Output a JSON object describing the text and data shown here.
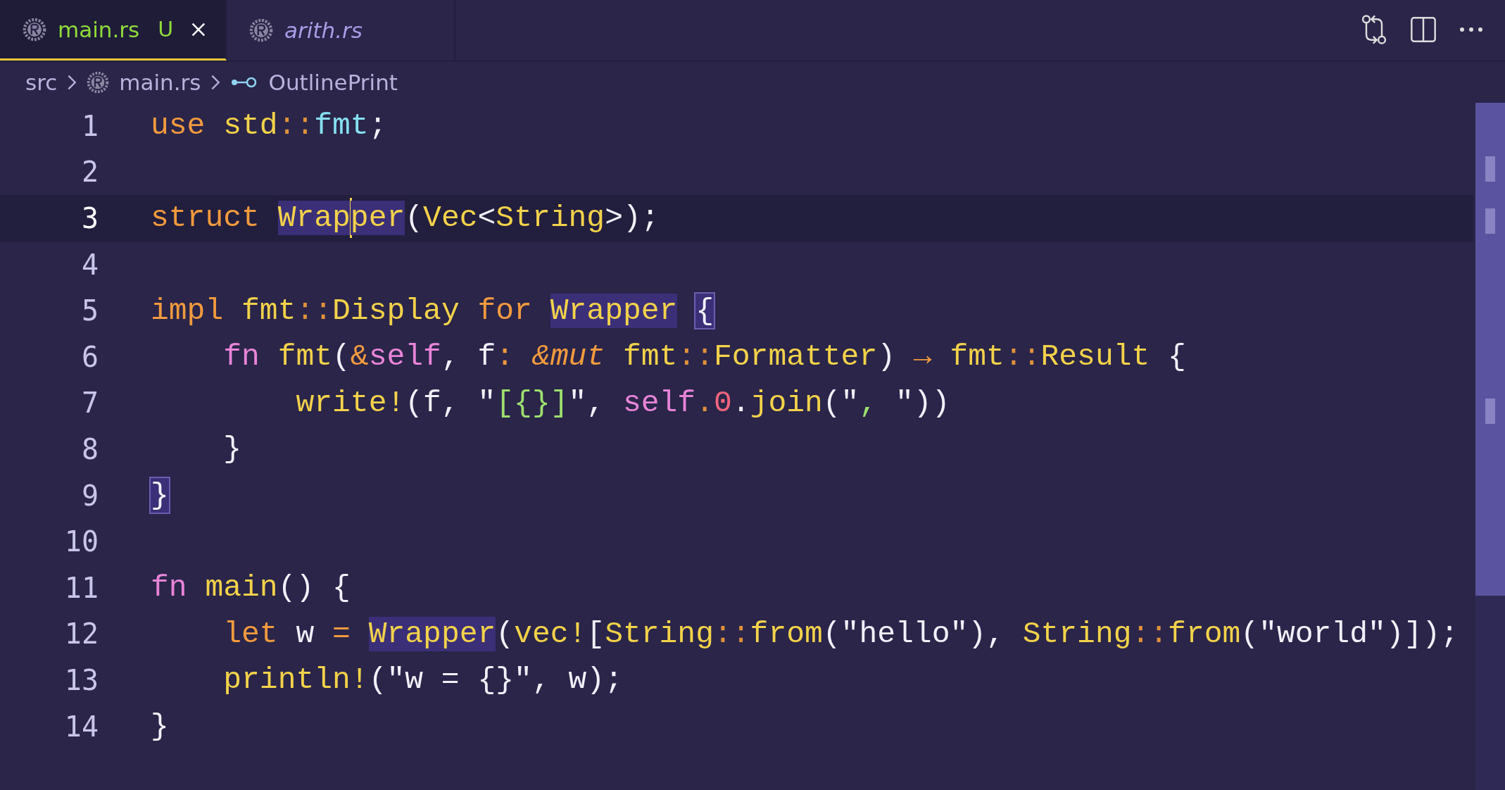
{
  "tabs": [
    {
      "label": "main.rs",
      "selected": true,
      "preview": false,
      "badge": "U",
      "closable": true
    },
    {
      "label": "arith.rs",
      "selected": false,
      "preview": true,
      "closable": false
    }
  ],
  "breadcrumb": [
    {
      "text": "src",
      "kind": "folder"
    },
    {
      "text": "main.rs",
      "kind": "file"
    },
    {
      "text": "OutlinePrint",
      "kind": "symbol"
    }
  ],
  "lines": [
    {
      "number": "1",
      "current": false,
      "tokens": [
        {
          "text": "use ",
          "kind": "keyword"
        },
        {
          "text": "std",
          "kind": "type"
        },
        {
          "text": "::",
          "kind": "op"
        },
        {
          "text": "fmt",
          "kind": "module"
        },
        {
          "text": ";",
          "kind": "plain"
        }
      ]
    },
    {
      "number": "2",
      "current": false
    },
    {
      "number": "3",
      "current": true,
      "tokens": [
        {
          "text": "struct ",
          "kind": "keyword"
        },
        {
          "text": "Wrap",
          "kind": "type",
          "highlighted": true,
          "caret": true
        },
        {
          "text": "per",
          "kind": "type",
          "highlighted": true
        },
        {
          "text": "(",
          "kind": "plain"
        },
        {
          "text": "Vec",
          "kind": "type"
        },
        {
          "text": "<",
          "kind": "plain"
        },
        {
          "text": "String",
          "kind": "type"
        },
        {
          "text": ">);",
          "kind": "plain"
        }
      ]
    },
    {
      "number": "4",
      "current": false
    },
    {
      "number": "5",
      "current": false,
      "tokens": [
        {
          "text": "impl ",
          "kind": "keyword"
        },
        {
          "text": "fmt",
          "kind": "type"
        },
        {
          "text": "::",
          "kind": "op"
        },
        {
          "text": "Display",
          "kind": "type"
        },
        {
          "text": " for ",
          "kind": "keyword"
        },
        {
          "text": "Wrapper",
          "kind": "type",
          "highlighted": true
        },
        {
          "text": "{",
          "kind": "plain",
          "bracket_match": true
        }
      ]
    },
    {
      "number": "6",
      "current": false,
      "tokens": [
        {
          "text": "    fn",
          "kind": "self"
        },
        {
          "text": " fmt",
          "kind": "type"
        },
        {
          "text": "(",
          "kind": "plain"
        },
        {
          "text": "&",
          "kind": "keyword"
        },
        {
          "text": "self",
          "kind": "self"
        },
        {
          "text": ", f",
          "kind": "plain"
        },
        {
          "text": ":",
          "kind": "keyword"
        },
        {
          "text": " &mut",
          "kind": "modifier"
        },
        {
          "text": " fmt",
          "kind": "type"
        },
        {
          "text": "::",
          "kind": "op"
        },
        {
          "text": "Formatter",
          "kind": "type"
        },
        {
          "text": ") ",
          "kind": "plain"
        },
        {
          "text": "→",
          "kind": "keyword"
        },
        {
          "text": " fmt",
          "kind": "type"
        },
        {
          "text": "::",
          "kind": "op"
        },
        {
          "text": "Result",
          "kind": "type"
        },
        {
          "text": " {",
          "kind": "plain"
        }
      ]
    },
    {
      "number": "7",
      "current": false,
      "tokens": [
        {
          "text": "        write!",
          "kind": "type"
        },
        {
          "text": "(f, \"",
          "kind": "plain"
        },
        {
          "text": "[{}]",
          "kind": "string"
        },
        {
          "text": "\", ",
          "kind": "plain"
        },
        {
          "text": "self",
          "kind": "self"
        },
        {
          "text": ".",
          "kind": "op"
        },
        {
          "text": "0",
          "kind": "number"
        },
        {
          "text": ".",
          "kind": "plain"
        },
        {
          "text": "join",
          "kind": "type"
        },
        {
          "text": "(\"",
          "kind": "plain"
        },
        {
          "text": ", ",
          "kind": "string"
        },
        {
          "text": "\"))",
          "kind": "plain"
        }
      ]
    },
    {
      "number": "8",
      "current": false,
      "tokens": [
        {
          "text": "    }",
          "kind": "plain"
        }
      ]
    },
    {
      "number": "9",
      "current": false,
      "tokens": [
        {
          "text": "}",
          "kind": "plain",
          "bracket_match": true
        }
      ]
    },
    {
      "number": "10",
      "current": false
    },
    {
      "number": "11",
      "current": false,
      "tokens": [
        {
          "text": "fn",
          "kind": "self"
        },
        {
          "text": " main",
          "kind": "type"
        },
        {
          "text": "() {",
          "kind": "plain"
        }
      ]
    },
    {
      "number": "12",
      "current": false,
      "tokens": [
        {
          "text": "    let",
          "kind": "keyword"
        },
        {
          "text": " w ",
          "kind": "plain"
        },
        {
          "text": "= ",
          "kind": "keyword"
        },
        {
          "text": "Wrapper",
          "kind": "type",
          "highlighted": true
        },
        {
          "text": "(",
          "kind": "plain"
        },
        {
          "text": "vec!",
          "kind": "type"
        },
        {
          "text": "[",
          "kind": "plain"
        },
        {
          "text": "String",
          "kind": "type"
        },
        {
          "text": "::",
          "kind": "op"
        },
        {
          "text": "from",
          "kind": "type"
        },
        {
          "text": "(\"hello\"), ",
          "kind": "plain"
        },
        {
          "text": "String",
          "kind": "type"
        },
        {
          "text": "::",
          "kind": "op"
        },
        {
          "text": "from",
          "kind": "type"
        },
        {
          "text": "(\"world\")]);",
          "kind": "plain"
        }
      ]
    },
    {
      "number": "13",
      "current": false,
      "tokens": [
        {
          "text": "    println!",
          "kind": "type"
        },
        {
          "text": "(\"w = {}\", w);",
          "kind": "plain"
        }
      ]
    },
    {
      "number": "14",
      "current": false,
      "tokens": [
        {
          "text": "}",
          "kind": "plain"
        }
      ]
    }
  ]
}
